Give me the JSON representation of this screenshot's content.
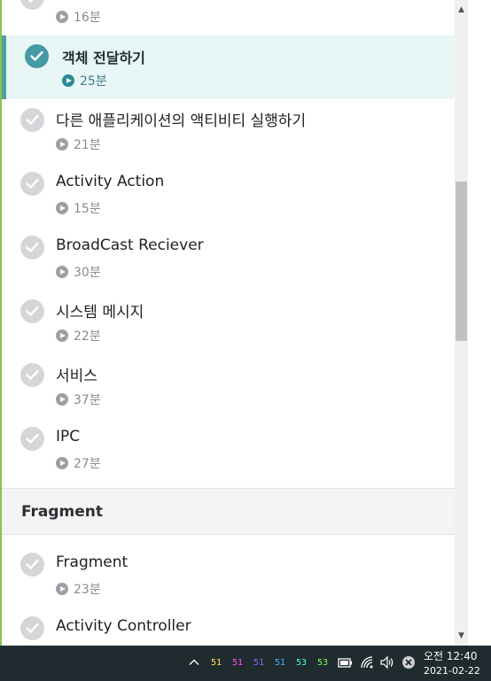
{
  "lessons_top": [
    {
      "duration": "16분",
      "active": false
    },
    {
      "title": "객체 전달하기",
      "duration": "25분",
      "active": true
    },
    {
      "title": "다른 애플리케이션의 액티비티 실행하기",
      "duration": "21분",
      "active": false
    },
    {
      "title": "Activity Action",
      "duration": "15분",
      "active": false
    },
    {
      "title": "BroadCast Reciever",
      "duration": "30분",
      "active": false
    },
    {
      "title": "시스템 메시지",
      "duration": "22분",
      "active": false
    },
    {
      "title": "서비스",
      "duration": "37분",
      "active": false
    },
    {
      "title": "IPC",
      "duration": "27분",
      "active": false
    }
  ],
  "section": {
    "title": "Fragment"
  },
  "lessons_bottom": [
    {
      "title": "Fragment",
      "duration": "23분",
      "active": false
    },
    {
      "title": "Activity Controller",
      "active": false
    }
  ],
  "icons": {
    "check": "check-icon",
    "play": "play-icon"
  },
  "colors": {
    "active_bg": "#e8f6f6",
    "active_accent": "#4f9fa0",
    "check_active": "#459aa6",
    "check_inactive": "#d4d6d9",
    "left_line": "#8bc34a",
    "taskbar": "#1f2b2f"
  },
  "taskbar": {
    "tray_numbers": [
      {
        "value": "51",
        "color": "#ffe34d"
      },
      {
        "value": "51",
        "color": "#ff4dff"
      },
      {
        "value": "51",
        "color": "#8f6bff"
      },
      {
        "value": "51",
        "color": "#46b4ff"
      },
      {
        "value": "53",
        "color": "#4dffd2"
      },
      {
        "value": "53",
        "color": "#7dff4d"
      }
    ],
    "time": "오전 12:40",
    "date": "2021-02-22"
  }
}
